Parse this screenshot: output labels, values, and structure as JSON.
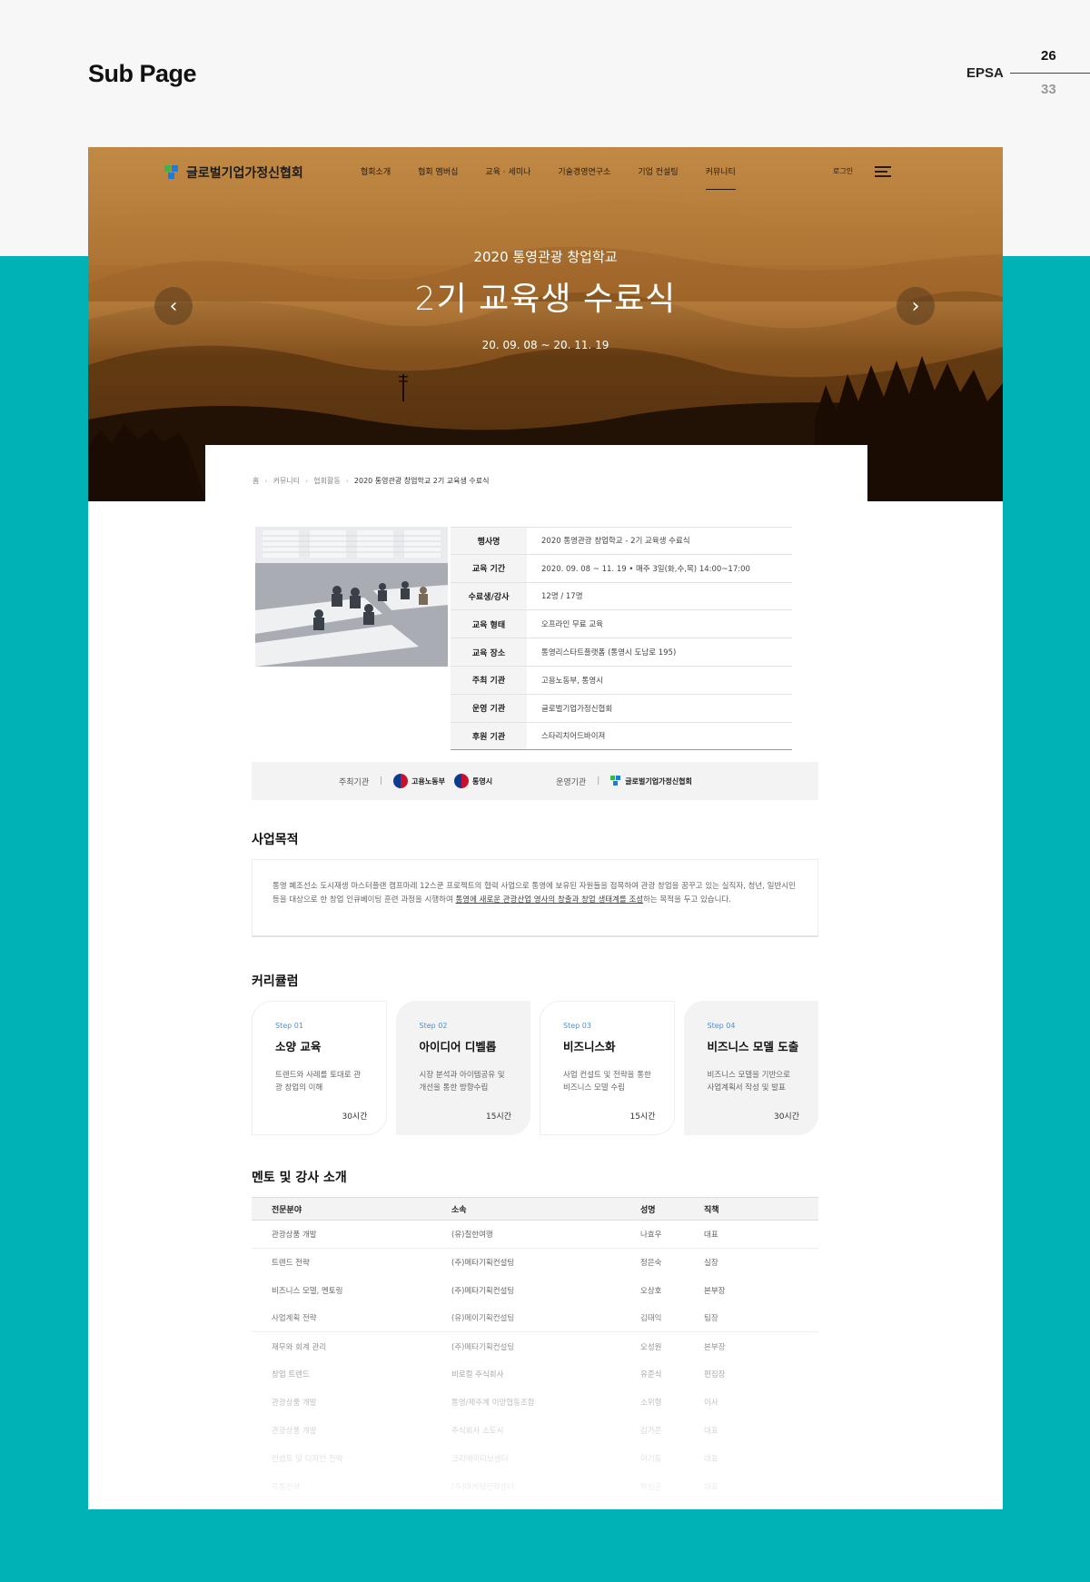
{
  "header": {
    "page_title": "Sub Page",
    "brand": "EPSA",
    "page_current": "26",
    "page_total": "33"
  },
  "site": {
    "logo_text": "글로벌기업가정신협회",
    "nav": [
      "협회소개",
      "협회 멤버십",
      "교육 · 세미나",
      "기술경영연구소",
      "기업 컨설팅",
      "커뮤니티"
    ],
    "active_nav": "커뮤니티",
    "login": "로그인"
  },
  "hero": {
    "subtitle": "2020 통영관광 창업학교",
    "title": "2기 교육생 수료식",
    "date": "20. 09. 08 ~ 20. 11. 19",
    "prev": "‹",
    "next": "›"
  },
  "breadcrumb": [
    "홈",
    "커뮤니티",
    "협회활동",
    "2020 통영관광 창업학교 2기 교육생 수료식"
  ],
  "info": [
    {
      "k": "행사명",
      "v": "2020 통영관광 창업학교 - 2기 교육생 수료식"
    },
    {
      "k": "교육 기간",
      "v": "2020. 09. 08 ~ 11. 19 • 매주 3일(화,수,목) 14:00~17:00"
    },
    {
      "k": "수료생/강사",
      "v": "12명 / 17명"
    },
    {
      "k": "교육 형태",
      "v": "오프라인 무료 교육"
    },
    {
      "k": "교육 장소",
      "v": "통영리스타트플랫폼 (통영시 도남로 195)"
    },
    {
      "k": "주최 기관",
      "v": "고용노동부, 통영시"
    },
    {
      "k": "운영 기관",
      "v": "글로벌기업가정신협회"
    },
    {
      "k": "후원 기관",
      "v": "스타리치어드바이져"
    }
  ],
  "hosts": {
    "label1": "주최기관",
    "org1": "고용노동부",
    "org2": "통영시",
    "label2": "운영기관",
    "org3": "글로벌기업가정신협회"
  },
  "purpose": {
    "heading": "사업목적",
    "text1": "통영 폐조선소 도시재생 마스터플랜 캠프마레 12스쿤 프로젝트의 협력 사업으로 통영에 보유된 자원들을 접목하여 관광 창업을 꿈꾸고 있는 실직자, 청년, 일반시민 등을 대상으로 한 창업 인큐베이팅 훈련 과정을 시행하여 ",
    "text_u": "통영에 새로운 관광산업 영사의 창출과 창업 생태계를 조성",
    "text2": "하는 목적을 두고 있습니다."
  },
  "curriculum": {
    "heading": "커리큘럼",
    "steps": [
      {
        "step": "Step 01",
        "title": "소양 교육",
        "desc": "트렌드와 사례를 토대로 관광 창업의 이해",
        "hours": "30시간"
      },
      {
        "step": "Step 02",
        "title": "아이디어 디벨롭",
        "desc": "시장 분석과 아이템공유 및 개선을 통한 방향수립",
        "hours": "15시간"
      },
      {
        "step": "Step 03",
        "title": "비즈니스화",
        "desc": "사업 컨설트 및 전략을 통한 비즈니스 모델 수립",
        "hours": "15시간"
      },
      {
        "step": "Step 04",
        "title": "비즈니스 모델 도출",
        "desc": "비즈니스 모델을 기반으로 사업계획서 작성 및 발표",
        "hours": "30시간"
      }
    ]
  },
  "mentors": {
    "heading": "멘토 및 강사 소개",
    "columns": [
      "전문분야",
      "소속",
      "성명",
      "직책"
    ],
    "rows": [
      [
        "관광상품 개발",
        "(유)칠한여행",
        "나효우",
        "대표"
      ],
      [
        "트렌드 전략",
        "(주)메타기획컨설팅",
        "정은숙",
        "실장"
      ],
      [
        "비즈니스 모델, 멘토링",
        "(주)메타기획컨설팅",
        "오상호",
        "본부장"
      ],
      [
        "사업계획 전략",
        "(유)메이기획컨설팅",
        "김태익",
        "팀장"
      ],
      [
        "재무와 회계 관리",
        "(주)메타기획컨설팅",
        "오성원",
        "본부장"
      ],
      [
        "창업 트렌드",
        "비로컬 주식회사",
        "유준식",
        "편집장"
      ],
      [
        "관광상품 개발",
        "통영/제주계 이망협동조합",
        "소위형",
        "이사"
      ],
      [
        "관광상품 개발",
        "주식회사 소도시",
        "김가은",
        "대표"
      ],
      [
        "컨셉트 및 디자인 전략",
        "크리에이티브센터",
        "이기동",
        "대표"
      ],
      [
        "유통전략",
        "(주)마케팅전략센터",
        "박성훈",
        "대표"
      ]
    ]
  },
  "colors": {
    "teal": "#00b2b5",
    "step_blue": "#4a90d9",
    "logo_blue": "#1e7bd6",
    "logo_green": "#3cb44b"
  }
}
